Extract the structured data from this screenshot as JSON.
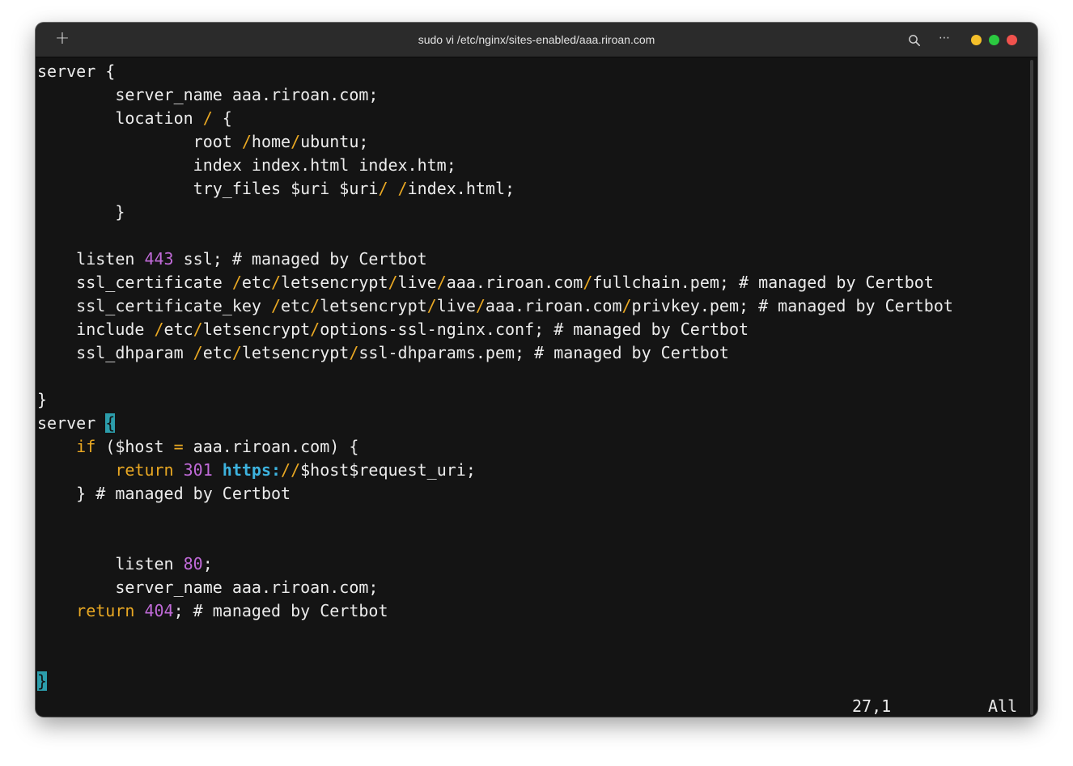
{
  "window": {
    "title": "sudo vi /etc/nginx/sites-enabled/aaa.riroan.com",
    "new_tab": "+",
    "menu": "⋯"
  },
  "editor": {
    "lines": [
      [
        {
          "t": "server {"
        }
      ],
      [
        {
          "t": "        server_name aaa.riroan.com;"
        }
      ],
      [
        {
          "t": "        location "
        },
        {
          "t": "/",
          "c": "sl"
        },
        {
          "t": " {"
        }
      ],
      [
        {
          "t": "                root "
        },
        {
          "t": "/",
          "c": "sl"
        },
        {
          "t": "home"
        },
        {
          "t": "/",
          "c": "sl"
        },
        {
          "t": "ubuntu;"
        }
      ],
      [
        {
          "t": "                index index.html index.htm;"
        }
      ],
      [
        {
          "t": "                try_files $uri $uri"
        },
        {
          "t": "/",
          "c": "sl"
        },
        {
          "t": " "
        },
        {
          "t": "/",
          "c": "sl"
        },
        {
          "t": "index.html;"
        }
      ],
      [
        {
          "t": "        }"
        }
      ],
      [],
      [
        {
          "t": "    listen "
        },
        {
          "t": "443",
          "c": "num"
        },
        {
          "t": " ssl; # managed by Certbot"
        }
      ],
      [
        {
          "t": "    ssl_certificate "
        },
        {
          "t": "/",
          "c": "sl"
        },
        {
          "t": "etc"
        },
        {
          "t": "/",
          "c": "sl"
        },
        {
          "t": "letsencrypt"
        },
        {
          "t": "/",
          "c": "sl"
        },
        {
          "t": "live"
        },
        {
          "t": "/",
          "c": "sl"
        },
        {
          "t": "aaa.riroan.com"
        },
        {
          "t": "/",
          "c": "sl"
        },
        {
          "t": "fullchain.pem; # managed by Certbot"
        }
      ],
      [
        {
          "t": "    ssl_certificate_key "
        },
        {
          "t": "/",
          "c": "sl"
        },
        {
          "t": "etc"
        },
        {
          "t": "/",
          "c": "sl"
        },
        {
          "t": "letsencrypt"
        },
        {
          "t": "/",
          "c": "sl"
        },
        {
          "t": "live"
        },
        {
          "t": "/",
          "c": "sl"
        },
        {
          "t": "aaa.riroan.com"
        },
        {
          "t": "/",
          "c": "sl"
        },
        {
          "t": "privkey.pem; # managed by Certbot"
        }
      ],
      [
        {
          "t": "    include "
        },
        {
          "t": "/",
          "c": "sl"
        },
        {
          "t": "etc"
        },
        {
          "t": "/",
          "c": "sl"
        },
        {
          "t": "letsencrypt"
        },
        {
          "t": "/",
          "c": "sl"
        },
        {
          "t": "options-ssl-nginx.conf; # managed by Certbot"
        }
      ],
      [
        {
          "t": "    ssl_dhparam "
        },
        {
          "t": "/",
          "c": "sl"
        },
        {
          "t": "etc"
        },
        {
          "t": "/",
          "c": "sl"
        },
        {
          "t": "letsencrypt"
        },
        {
          "t": "/",
          "c": "sl"
        },
        {
          "t": "ssl-dhparams.pem; # managed by Certbot"
        }
      ],
      [],
      [
        {
          "t": "}"
        }
      ],
      [
        {
          "t": "server "
        },
        {
          "t": "{",
          "c": "cursor"
        }
      ],
      [
        {
          "t": "    "
        },
        {
          "t": "if",
          "c": "kw"
        },
        {
          "t": " ($host "
        },
        {
          "t": "=",
          "c": "kw"
        },
        {
          "t": " aaa.riroan.com) {"
        }
      ],
      [
        {
          "t": "        "
        },
        {
          "t": "return",
          "c": "kw"
        },
        {
          "t": " "
        },
        {
          "t": "301",
          "c": "num"
        },
        {
          "t": " "
        },
        {
          "t": "https:",
          "c": "url"
        },
        {
          "t": "//",
          "c": "sl"
        },
        {
          "t": "$host$request_uri;"
        }
      ],
      [
        {
          "t": "    } # managed by Certbot"
        }
      ],
      [],
      [],
      [
        {
          "t": "        listen "
        },
        {
          "t": "80",
          "c": "num"
        },
        {
          "t": ";"
        }
      ],
      [
        {
          "t": "        server_name aaa.riroan.com;"
        }
      ],
      [
        {
          "t": "    "
        },
        {
          "t": "return",
          "c": "kw"
        },
        {
          "t": " "
        },
        {
          "t": "404",
          "c": "num"
        },
        {
          "t": "; # managed by Certbot"
        }
      ],
      [],
      [],
      [
        {
          "t": "}",
          "c": "cursor"
        }
      ]
    ]
  },
  "status": {
    "position": "27,1",
    "scroll": "All"
  }
}
